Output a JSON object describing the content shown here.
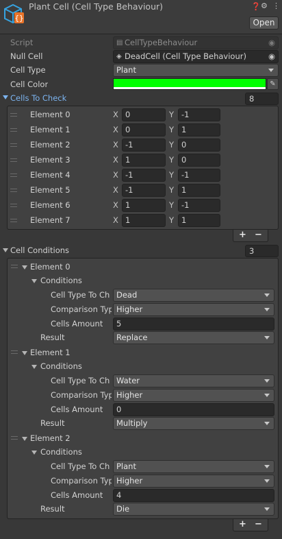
{
  "header": {
    "title": "Plant Cell (Cell Type Behaviour)",
    "open_label": "Open",
    "icon_help": "help-icon",
    "icon_settings": "settings-icon",
    "icon_more": "more-icon",
    "icon_script": "script-asset-icon"
  },
  "fields": {
    "script_label": "Script",
    "script_value": "CellTypeBehaviour",
    "null_cell_label": "Null Cell",
    "null_cell_value": "DeadCell (Cell Type Behaviour)",
    "cell_type_label": "Cell Type",
    "cell_type_value": "Plant",
    "cell_color_label": "Cell Color",
    "cell_color_value": "#00ff00"
  },
  "cells_to_check": {
    "label": "Cells To Check",
    "size": "8",
    "x_label": "X",
    "y_label": "Y",
    "elements": [
      {
        "name": "Element 0",
        "x": "0",
        "y": "-1"
      },
      {
        "name": "Element 1",
        "x": "0",
        "y": "1"
      },
      {
        "name": "Element 2",
        "x": "-1",
        "y": "0"
      },
      {
        "name": "Element 3",
        "x": "1",
        "y": "0"
      },
      {
        "name": "Element 4",
        "x": "-1",
        "y": "-1"
      },
      {
        "name": "Element 5",
        "x": "-1",
        "y": "1"
      },
      {
        "name": "Element 6",
        "x": "1",
        "y": "-1"
      },
      {
        "name": "Element 7",
        "x": "1",
        "y": "1"
      }
    ]
  },
  "cell_conditions": {
    "label": "Cell Conditions",
    "size": "3",
    "conditions_label": "Conditions",
    "cell_type_label": "Cell Type To Ch",
    "comparison_label": "Comparison Typ",
    "cells_amount_label": "Cells Amount",
    "result_label": "Result",
    "elements": [
      {
        "name": "Element 0",
        "cell_type": "Dead",
        "comparison": "Higher",
        "amount": "5",
        "result": "Replace"
      },
      {
        "name": "Element 1",
        "cell_type": "Water",
        "comparison": "Higher",
        "amount": "0",
        "result": "Multiply"
      },
      {
        "name": "Element 2",
        "cell_type": "Plant",
        "comparison": "Higher",
        "amount": "4",
        "result": "Die"
      }
    ]
  },
  "list_controls": {
    "plus": "+",
    "minus": "−"
  },
  "colors": {
    "accent_blue": "#7cb4f0",
    "cell_color": "#00ff00"
  }
}
